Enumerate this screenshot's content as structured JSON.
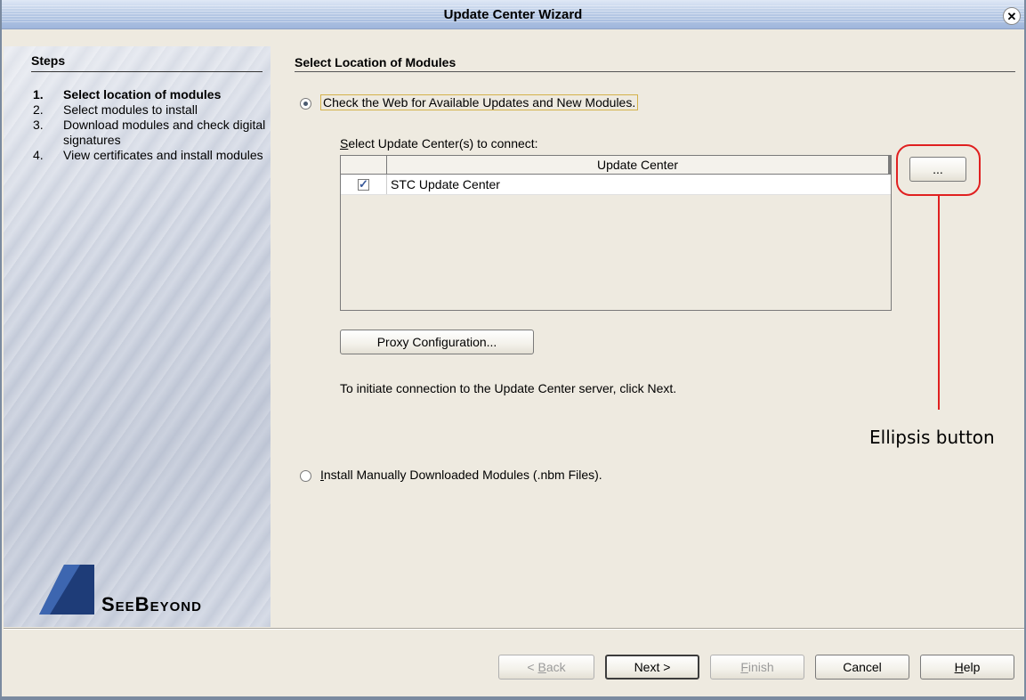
{
  "window": {
    "title": "Update Center Wizard"
  },
  "sidebar": {
    "header": "Steps",
    "steps": [
      {
        "num": "1.",
        "label": "Select location of modules"
      },
      {
        "num": "2.",
        "label": "Select modules to install"
      },
      {
        "num": "3.",
        "label": "Download modules and check digital signatures"
      },
      {
        "num": "4.",
        "label": "View certificates and install modules"
      }
    ],
    "logo_text": "SeeBeyond"
  },
  "main": {
    "header": "Select Location of Modules",
    "option_web": {
      "label": "Check the Web for Available Updates and New Modules.",
      "selected": true
    },
    "select_label": "Select Update Center(s) to connect:",
    "table": {
      "column_header": "Update Center",
      "rows": [
        {
          "checked": true,
          "name": "STC Update Center"
        }
      ]
    },
    "ellipsis_label": "...",
    "proxy_button": "Proxy Configuration...",
    "hint": "To initiate connection to the Update Center server, click Next.",
    "option_manual": {
      "label": "Install Manually Downloaded Modules (.nbm Files).",
      "selected": false
    }
  },
  "annotation": {
    "label": "Ellipsis button",
    "color": "#e02020"
  },
  "footer": {
    "back": "< Back",
    "next": "Next >",
    "finish": "Finish",
    "cancel": "Cancel",
    "help": "Help"
  }
}
